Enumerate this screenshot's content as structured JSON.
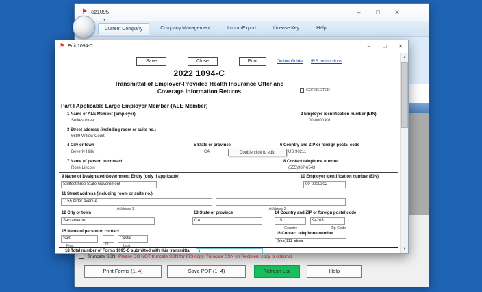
{
  "colors": {
    "desktop": "#1f63b4",
    "refresh_button": "#17c05c",
    "warning_text": "#d03030",
    "selected_row": "#4e80bd",
    "link": "#0645c8"
  },
  "main_window": {
    "title": "ez1095",
    "tabs": [
      {
        "label": "Current Company"
      },
      {
        "label": "Company Management"
      },
      {
        "label": "Import/Export"
      },
      {
        "label": "License Key"
      },
      {
        "label": "Help"
      }
    ],
    "truncate": {
      "checkbox_label": "Truncate SSN",
      "warning": "Please DO NOT truncate SSN for IRS copy. Truncate SSN on Recipient copy is optional."
    },
    "buttons": {
      "print_forms": "Print Forms (1, 4)",
      "save_pdf": "Save PDF (1, 4)",
      "refresh": "Refresh List",
      "help": "Help"
    }
  },
  "dialog": {
    "title": "Edit 1094-C",
    "toolbar": {
      "save": "Save",
      "close": "Close",
      "print": "Print",
      "online_guide": "Online Guide",
      "irs_instructions": "IRS Instructions"
    },
    "form": {
      "title": "2022 1094-C",
      "subtitle1": "Transmittal of Employer-Provided Health Insurance Offer and",
      "subtitle2": "Coverage Information Returns",
      "corrected_label": "CORRECTED",
      "part1_heading": "Part I Applicable Large Employer Member (ALE Member)",
      "tooltip": "Double click to edit.",
      "fields": {
        "f1": {
          "label": "1 Name of ALE Member (Employer)",
          "value": "Selltestthree"
        },
        "f2": {
          "label": "2 Employer identification number (EIN)",
          "value": "00-0000301"
        },
        "f3": {
          "label": "3 Street address (including room or suite no.)",
          "value": "6689 Willow Court"
        },
        "f4": {
          "label": "4 City or town",
          "value": "Beverly Hills"
        },
        "f5": {
          "label": "5 State or province",
          "value": "CA"
        },
        "f6": {
          "label": "6 Country and ZIP or foreign postal code",
          "value": "US 90211"
        },
        "f7": {
          "label": "7 Name of person to contact",
          "value": "Rose Lincoln"
        },
        "f8": {
          "label": "8 Contact telephone number",
          "value": "(555)987-6543"
        },
        "f9": {
          "label": "9 Name of Designated Government Entity (only if applicable)",
          "value": "Selltestthree State Government"
        },
        "f10": {
          "label": "10 Employer identification number (EIN)",
          "value": "00-0000302"
        },
        "f11": {
          "label": "11 Street address (including room or suite no.)",
          "value": "1155 Alder Avenue",
          "value2": "",
          "sub1": "Address 1",
          "sub2": "Address 2"
        },
        "f12": {
          "label": "12 City or town",
          "value": "Sacramento"
        },
        "f13": {
          "label": "13 State or province",
          "value": "CA"
        },
        "f14": {
          "label": "14 Country and ZIP or foreign postal code",
          "country": "US",
          "zip": "94203",
          "sub_country": "Country",
          "sub_zip": "Zip Code"
        },
        "f15": {
          "label": "15 Name of person to contact",
          "first": "Sam",
          "middle": "",
          "last": "Castle",
          "sub_first": "First",
          "sub_middle": "M",
          "sub_last": "Last"
        },
        "f16": {
          "label": "16 Contact telephone number",
          "value": "(555)111-5555"
        },
        "f18": {
          "label": "18 Total number of Forms 1095-C submitted with this transmittal",
          "value": "3"
        }
      }
    }
  }
}
